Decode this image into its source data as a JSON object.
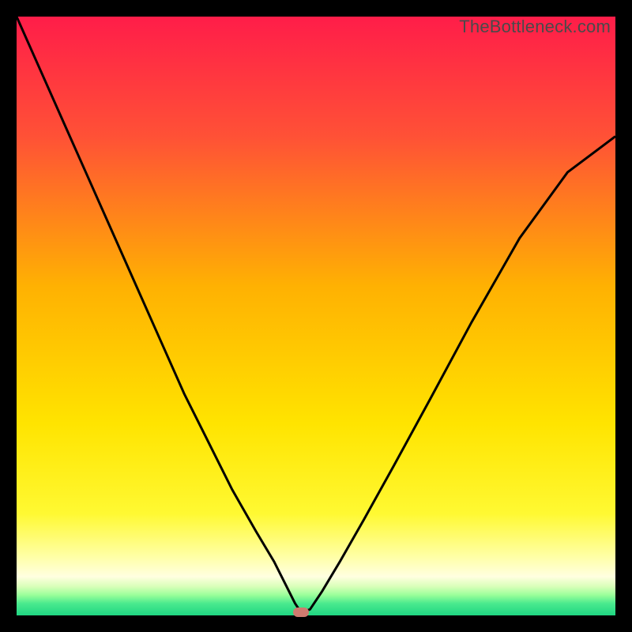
{
  "watermark": "TheBottleneck.com",
  "colors": {
    "frame_bg": "#000000",
    "curve_stroke": "#000000",
    "marker_fill": "#cf7a6f"
  },
  "gradient_stops": [
    {
      "pct": 0,
      "color": "#ff1d49"
    },
    {
      "pct": 20,
      "color": "#ff5136"
    },
    {
      "pct": 45,
      "color": "#ffb102"
    },
    {
      "pct": 68,
      "color": "#ffe400"
    },
    {
      "pct": 83,
      "color": "#fff932"
    },
    {
      "pct": 90,
      "color": "#ffffa3"
    },
    {
      "pct": 93.5,
      "color": "#ffffe0"
    },
    {
      "pct": 95.2,
      "color": "#d8ffb8"
    },
    {
      "pct": 96.6,
      "color": "#9aff9a"
    },
    {
      "pct": 98,
      "color": "#4aea8e"
    },
    {
      "pct": 100,
      "color": "#1fd682"
    }
  ],
  "chart_data": {
    "type": "line",
    "title": "",
    "xlabel": "",
    "ylabel": "",
    "xlim": [
      0,
      100
    ],
    "ylim": [
      0,
      100
    ],
    "series": [
      {
        "name": "bottleneck-curve",
        "x": [
          0,
          4,
          8,
          12,
          16,
          20,
          24,
          28,
          32,
          36,
          40,
          43,
          45,
          46.5,
          47.5,
          49,
          51,
          54,
          58,
          63,
          69,
          76,
          84,
          92,
          100
        ],
        "values": [
          100,
          91,
          82,
          73,
          64,
          55,
          46,
          37,
          29,
          21,
          14,
          9,
          5,
          2,
          0.5,
          1,
          4,
          9,
          16,
          25,
          36,
          49,
          63,
          74,
          80
        ]
      }
    ],
    "annotations": [
      {
        "name": "optimum-marker",
        "x": 47.5,
        "y": 0.5
      }
    ],
    "legend": "none",
    "grid": false
  }
}
